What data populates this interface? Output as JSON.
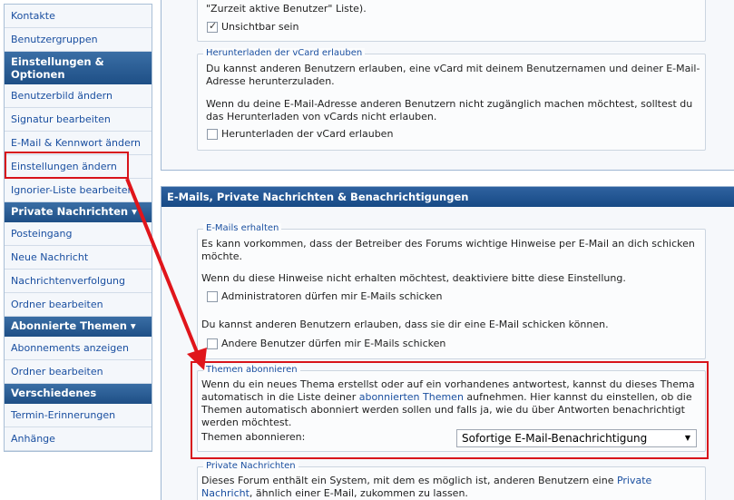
{
  "sidebar": {
    "items": [
      {
        "label": "Kontakte"
      },
      {
        "label": "Benutzergruppen"
      },
      {
        "label": "Einstellungen & Optionen"
      },
      {
        "label": "Benutzerbild ändern"
      },
      {
        "label": "Signatur bearbeiten"
      },
      {
        "label": "E-Mail & Kennwort ändern"
      },
      {
        "label": "Einstellungen ändern"
      },
      {
        "label": "Ignorier-Liste bearbeiten"
      },
      {
        "label": "Private Nachrichten ▾"
      },
      {
        "label": "Posteingang"
      },
      {
        "label": "Neue Nachricht"
      },
      {
        "label": "Nachrichtenverfolgung"
      },
      {
        "label": "Ordner bearbeiten"
      },
      {
        "label": "Abonnierte Themen ▾"
      },
      {
        "label": "Abonnements anzeigen"
      },
      {
        "label": "Ordner bearbeiten"
      },
      {
        "label": "Verschiedenes"
      },
      {
        "label": "Termin-Erinnerungen"
      },
      {
        "label": "Anhänge"
      }
    ]
  },
  "panel1": {
    "invisible_text": "\"Zurzeit aktive Benutzer\" Liste).",
    "invisible_label": "Unsichtbar sein",
    "vcard_legend": "Herunterladen der vCard erlauben",
    "vcard_para1": "Du kannst anderen Benutzern erlauben, eine vCard mit deinem Benutzernamen und deiner E-Mail-Adresse herunterzuladen.",
    "vcard_para2": "Wenn du deine E-Mail-Adresse anderen Benutzern nicht zugänglich machen möchtest, solltest du das Herunterladen von vCards nicht erlauben.",
    "vcard_label": "Herunterladen der vCard erlauben"
  },
  "panel2": {
    "header": "E-Mails, Private Nachrichten & Benachrichtigungen",
    "emails_legend": "E-Mails erhalten",
    "emails_para1": "Es kann vorkommen, dass der Betreiber des Forums wichtige Hinweise per E-Mail an dich schicken möchte.",
    "emails_para2": "Wenn du diese Hinweise nicht erhalten möchtest, deaktiviere bitte diese Einstellung.",
    "admins_label": "Administratoren dürfen mir E-Mails schicken",
    "emails_para3": "Du kannst anderen Benutzern erlauben, dass sie dir eine E-Mail schicken können.",
    "others_label": "Andere Benutzer dürfen mir E-Mails schicken",
    "subscribe_legend": "Themen abonnieren",
    "subscribe_para_a": "Wenn du ein neues Thema erstellst oder auf ein vorhandenes antwortest, kannst du dieses Thema automatisch in die Liste deiner ",
    "subscribe_link": "abonnierten Themen",
    "subscribe_para_b": " aufnehmen. Hier kannst du einstellen, ob die Themen automatisch abonniert werden sollen und falls ja, wie du über Antworten benachrichtigt werden möchtest.",
    "subscribe_select_label": "Themen abonnieren:",
    "subscribe_select_value": "Sofortige E-Mail-Benachrichtigung",
    "pm_legend": "Private Nachrichten",
    "pm_para_a": "Dieses Forum enthält ein System, mit dem es möglich ist, anderen Benutzern eine ",
    "pm_link": "Private Nachricht",
    "pm_para_b": ", ähnlich einer E-Mail, zukommen zu lassen."
  },
  "colors": {
    "accent": "#1e4f86",
    "link": "#1a4fa0",
    "highlight": "#d8141b"
  }
}
